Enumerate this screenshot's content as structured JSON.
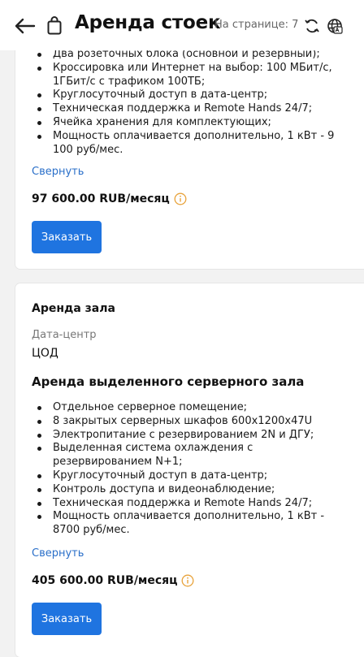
{
  "header": {
    "title": "Аренда стоек",
    "page_info": "На странице: 7"
  },
  "card1": {
    "features": [
      "Два розеточных блока (основной и резервный);",
      "Кроссировка или Интернет на выбор: 100 МБит/с, 1ГБит/с с трафиком 100ТБ;",
      "Круглосуточный доступ в дата-центр;",
      "Техническая поддержка и Remote Hands 24/7;",
      "Ячейка хранения для комплектующих;",
      "Мощность оплачивается дополнительно, 1 кВт - 9 100 руб/мес."
    ],
    "collapse_label": "Свернуть",
    "price": "97 600.00 RUB/месяц",
    "order_label": "Заказать"
  },
  "card2": {
    "section_title": "Аренда зала",
    "datacenter_label": "Дата-центр",
    "datacenter_value": "ЦОД",
    "service_title": "Аренда выделенного серверного зала",
    "features": [
      "Отдельное серверное помещение;",
      "8 закрытых серверных шкафов 600x1200x47U",
      "Электропитание с резервированием 2N и ДГУ;",
      "Выделенная система охлаждения с резервированием N+1;",
      "Круглосуточный доступ в дата-центр;",
      "Контроль доступа и видеонаблюдение;",
      "Техническая поддержка и Remote Hands 24/7;",
      "Мощность оплачивается дополнительно, 1 кВт - 8700 руб/мес."
    ],
    "collapse_label": "Свернуть",
    "price": "405 600.00 RUB/месяц",
    "order_label": "Заказать"
  },
  "colors": {
    "accent": "#1f74e0",
    "link": "#2a6fc9",
    "info": "#e8a33c"
  },
  "icons": {
    "back": "arrow-left-icon",
    "cart": "shopping-bag-icon",
    "refresh": "refresh-icon",
    "language": "globe-icon",
    "info": "info-icon"
  }
}
